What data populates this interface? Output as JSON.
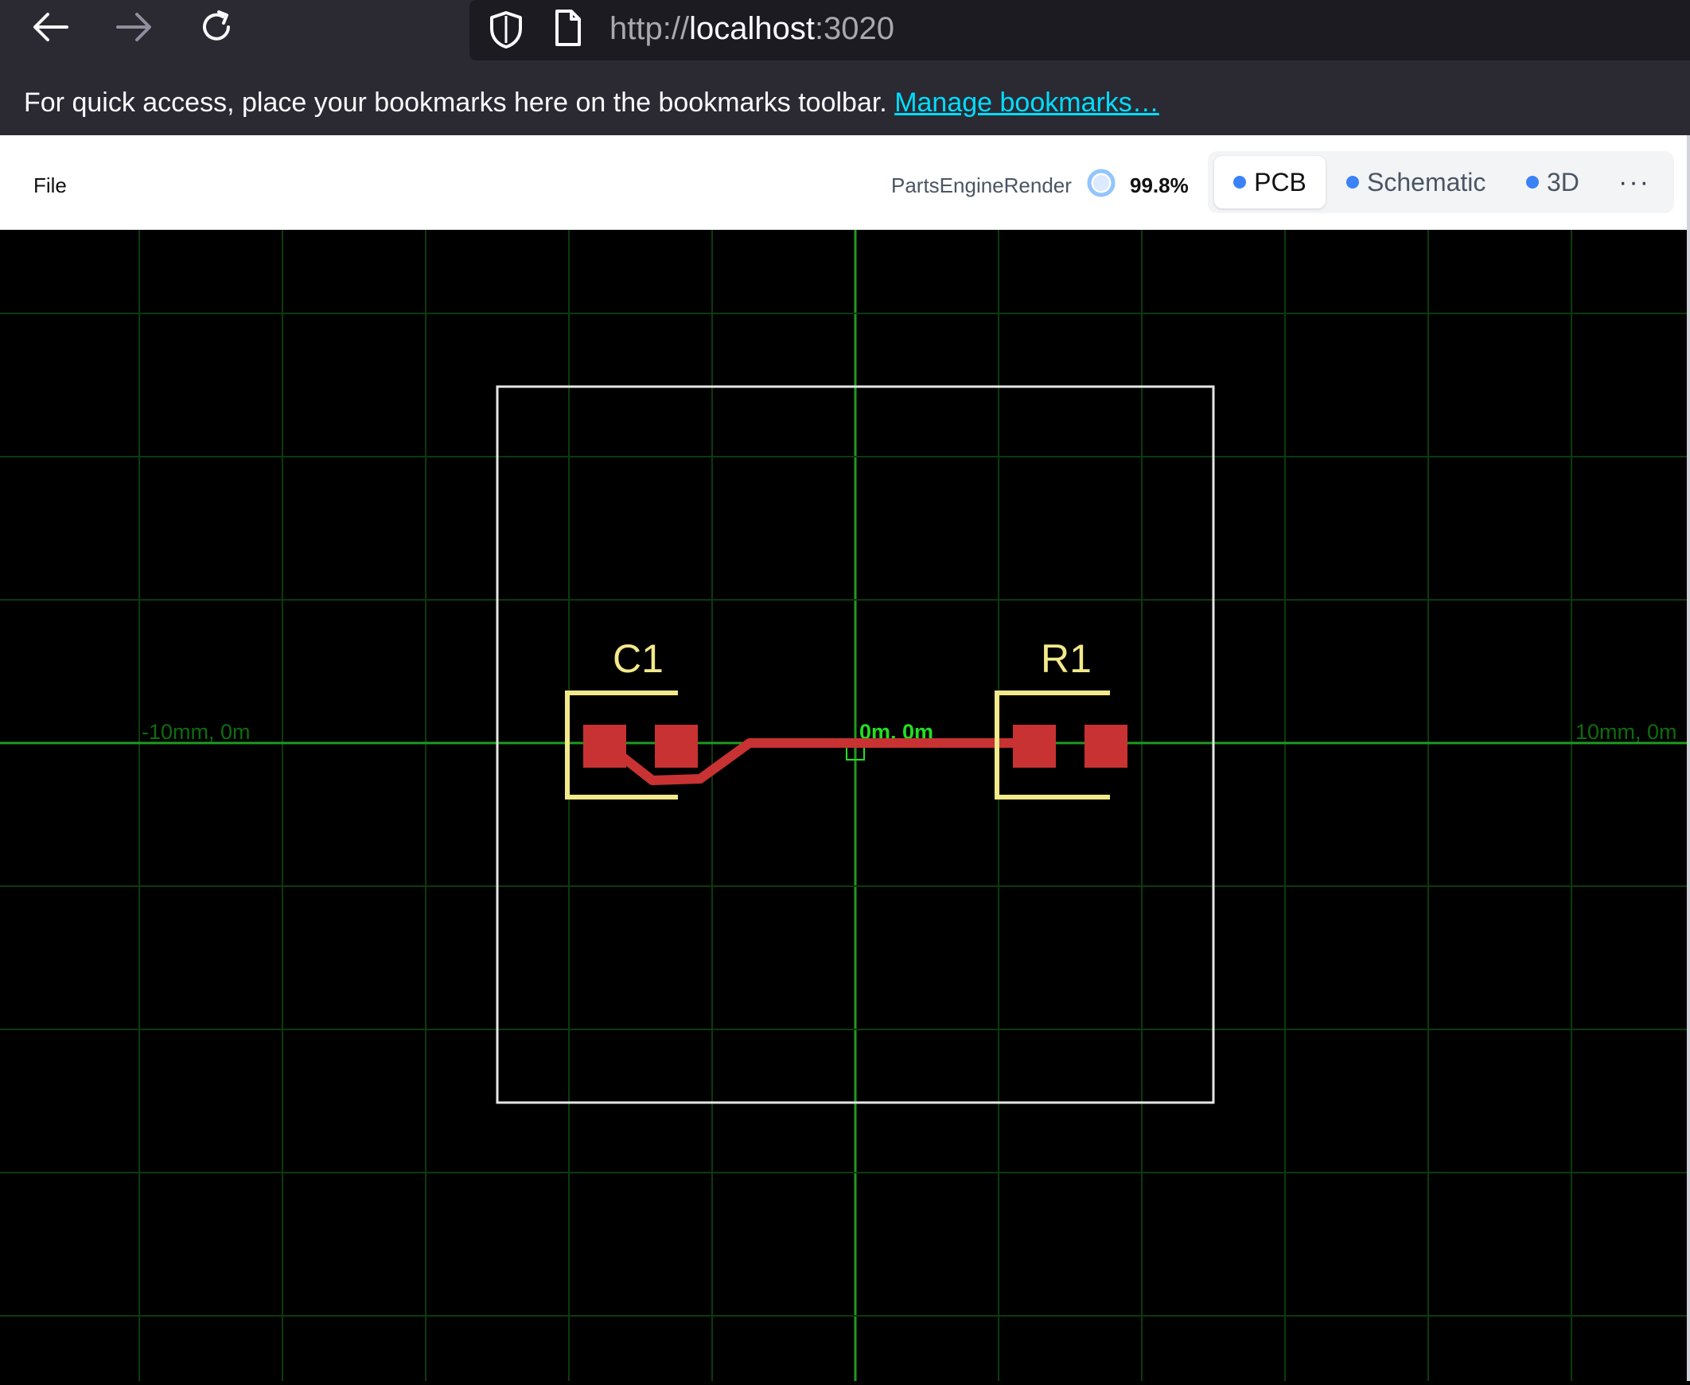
{
  "browser": {
    "url_scheme": "http://",
    "url_host": "localhost",
    "url_port": ":3020",
    "bookmarks_message": "For quick access, place your bookmarks here on the bookmarks toolbar.",
    "manage_bookmarks_label": "Manage bookmarks…",
    "icons": [
      "back-arrow-icon",
      "forward-arrow-icon",
      "reload-icon",
      "shield-icon",
      "page-icon"
    ]
  },
  "toolbar": {
    "file_label": "File",
    "render_label": "PartsEngineRender",
    "progress": "99.8%",
    "tabs": [
      {
        "label": "PCB",
        "active": true
      },
      {
        "label": "Schematic",
        "active": false
      },
      {
        "label": "3D",
        "active": false
      }
    ],
    "more_label": "···"
  },
  "pcb": {
    "axis_labels": {
      "left": "-10mm, 0m",
      "center": "0m, 0m",
      "right": "10mm, 0m"
    },
    "components": [
      {
        "ref": "C1"
      },
      {
        "ref": "R1"
      }
    ],
    "colors": {
      "grid": "#0d3a0d",
      "axis": "#1f9a1f",
      "board_outline": "#e6e6e6",
      "silkscreen": "#f2e98a",
      "copper": "#c83232",
      "axis_label": "#0f6b0f",
      "origin_label": "#22e022"
    }
  }
}
